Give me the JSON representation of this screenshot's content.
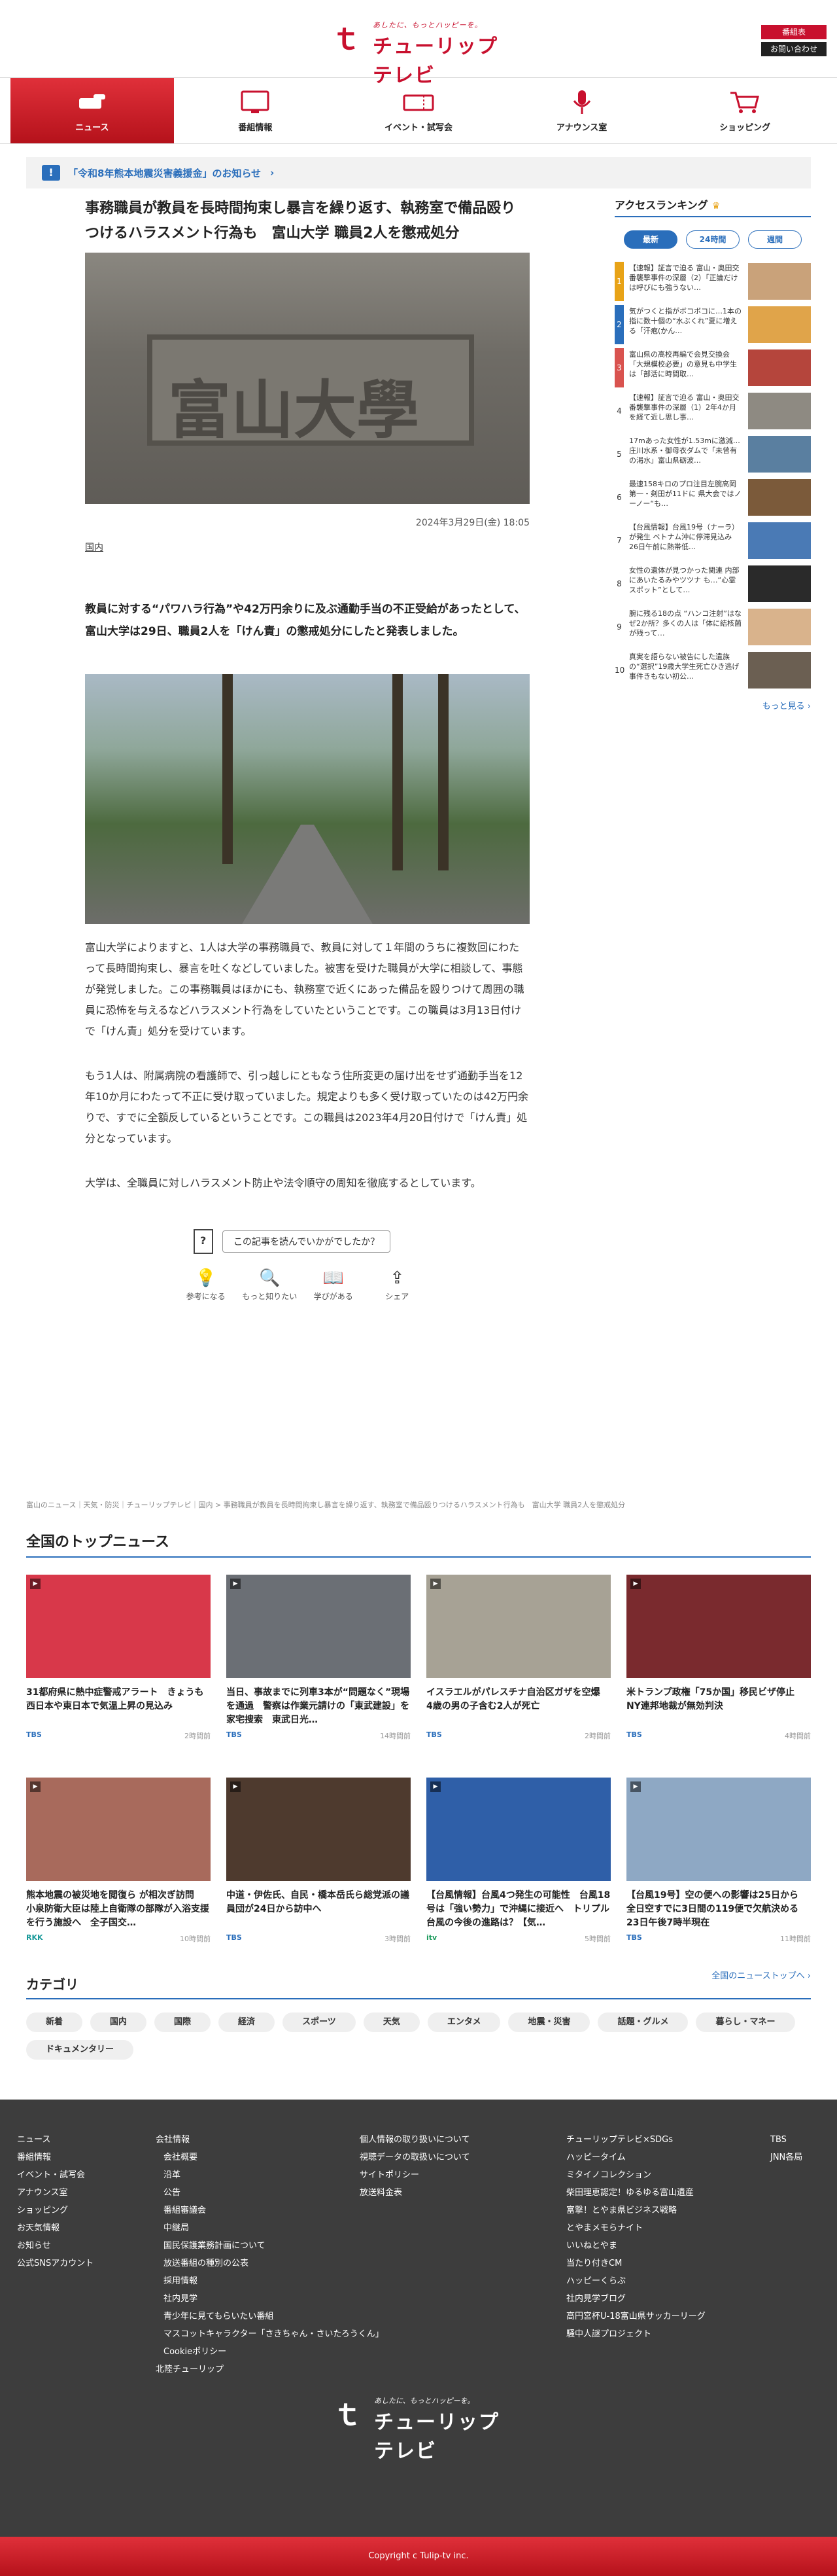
{
  "header": {
    "logo_tagline": "あしたに、もっとハッピーを。",
    "logo_name": "チューリップテレビ",
    "program_table": "番組表",
    "contact": "お問い合わせ"
  },
  "nav": [
    "ニュース",
    "番組情報",
    "イベント・試写会",
    "アナウンス室",
    "ショッピング"
  ],
  "notice": "「令和8年熊本地震災害義援金」のお知らせ",
  "article": {
    "title": "事務職員が教員を長時間拘束し暴言を繰り返す、執務室で備品殴りつけるハラスメント行為も　富山大学 職員2人を懲戒処分",
    "plate_text": "富山大學",
    "date": "2024年3月29日(金) 18:05",
    "category": "国内",
    "lead": "教員に対する“パワハラ行為”や42万円余りに及ぶ通勤手当の不正受給があったとして、富山大学は29日、職員2人を「けん責」の懲戒処分にしたと発表しました。",
    "paragraphs": [
      "富山大学によりますと、1人は大学の事務職員で、教員に対して１年間のうちに複数回にわたって長時間拘束し、暴言を吐くなどしていました。被害を受けた職員が大学に相談して、事態が発覚しました。この事務職員はほかにも、執務室で近くにあった備品を殴りつけて周囲の職員に恐怖を与えるなどハラスメント行為をしていたということです。この職員は3月13日付けで「けん責」処分を受けています。",
      "もう1人は、附属病院の看護師で、引っ越しにともなう住所変更の届け出をせず通勤手当を12年10か月にわたって不正に受け取っていました。規定よりも多く受け取っていたのは42万円余りで、すでに全額反しているということです。この職員は2023年4月20日付けで「けん責」処分となっています。",
      "大学は、全職員に対しハラスメント防止や法令順守の周知を徹底するとしています。"
    ],
    "feedback_q": "この記事を読んでいかがでしたか？",
    "feedback_actions": [
      "参考になる",
      "もっと知りたい",
      "学びがある",
      "シェア"
    ]
  },
  "ranking": {
    "title": "アクセスランキング",
    "tabs": [
      "最新",
      "24時間",
      "週間"
    ],
    "items": [
      {
        "rank": "1",
        "text": "【速報】証言で迫る 富山・奥田交番襲撃事件の深層（2）「正論だけは呼びにも強うない…"
      },
      {
        "rank": "2",
        "text": "気がつくと指がボコボコに…1本の指に数十個の“水ぶくれ”夏に増える「汗疱(かん…"
      },
      {
        "rank": "3",
        "text": "富山県の高校再編で会見交換会「大規模校必要」の意見も中学生は「部活に時間取…"
      },
      {
        "rank": "4",
        "text": "【速報】証言で迫る 富山・奥田交番襲撃事件の深層（1）2年4か月を経て近し思し事…"
      },
      {
        "rank": "5",
        "text": "17mあった女性が1.53mに激減…庄川水系・御母衣ダムで「未曾有の渇水」富山県砺波…"
      },
      {
        "rank": "6",
        "text": "最速158キロのプロ注目左腕高岡第一・剣田が11ドに 県大会ではノーノー“も…"
      },
      {
        "rank": "7",
        "text": "【台風情報】台風19号（ナーラ）が発生 ベトナム沖に停滞見込み 26日午前に熱帯低…"
      },
      {
        "rank": "8",
        "text": "女性の遺体が見つかった関連 内部にあいたるみやツツナ も…“心霊スポット”として…"
      },
      {
        "rank": "9",
        "text": "腕に残る18の点 “ハンコ注射”はなぜ2か所？多くの人は「体に結核菌が残って…"
      },
      {
        "rank": "10",
        "text": "真実を語らない被告にした遺族の“選択”19歳大学生死亡ひき逃げ事件きもない初公…"
      }
    ],
    "more": "もっと見る"
  },
  "breadcrumb": "富山のニュース｜天気・防災｜チューリップテレビ｜国内 > 事務職員が教員を長時間拘束し暴言を繰り返す、執務室で備品殴りつけるハラスメント行為も　富山大学 職員2人を懲戒処分",
  "topnews": {
    "title": "全国のトップニュース",
    "items": [
      {
        "title": "31都府県に熱中症警戒アラート　きょうも西日本や東日本で気温上昇の見込み",
        "src": "TBS",
        "time": "2時間前",
        "bg": "#d8384a"
      },
      {
        "title": "当日、事故までに列車3本が“問題なく”現場を通過　警察は作業元請けの「東武建設」を家宅捜索　東武日光…",
        "src": "TBS",
        "time": "14時間前",
        "bg": "#6b6f75"
      },
      {
        "title": "イスラエルがパレスチナ自治区ガザを空爆　4歳の男の子含む2人が死亡",
        "src": "TBS",
        "time": "2時間前",
        "bg": "#a7a295"
      },
      {
        "title": "米トランプ政権「75か国」移民ビザ停止　NY連邦地裁が無効判決",
        "src": "TBS",
        "time": "4時間前",
        "bg": "#7a2a2e"
      },
      {
        "title": "熊本地震の被災地を閲復ら が相次ぎ訪問　小泉防衛大臣は陸上自衛隊の部隊が入浴支援を行う施設へ　全子国交…",
        "src": "RKK",
        "time": "10時間前",
        "bg": "#a86a5c"
      },
      {
        "title": "中道・伊佐氏、自民・橋本岳氏ら総党派の議員団が24日から訪中へ",
        "src": "TBS",
        "time": "3時間前",
        "bg": "#4e3a2e"
      },
      {
        "title": "【台風情報】台風4つ発生の可能性　台風18号は「強い勢力」で沖縄に接近へ　トリプル台風の今後の進路は？【気…",
        "src": "itv",
        "time": "5時間前",
        "bg": "#2f5fa8"
      },
      {
        "title": "【台風19号】空の便への影響は25日から　全日空すでに3日間の119便で欠航決める　23日午後7時半現在",
        "src": "TBS",
        "time": "11時間前",
        "bg": "#8ea8c4"
      }
    ],
    "more": "全国のニューストップへ"
  },
  "categories": {
    "title": "カテゴリ",
    "items": [
      "新着",
      "国内",
      "国際",
      "経済",
      "スポーツ",
      "天気",
      "エンタメ",
      "地震・災害",
      "話題・グルメ",
      "暮らし・マネー",
      "ドキュメンタリー"
    ]
  },
  "footer": {
    "col1": [
      "ニュース",
      "番組情報",
      "イベント・試写会",
      "アナウンス室",
      "ショッピング",
      "お天気情報",
      "お知らせ",
      "公式SNSアカウント"
    ],
    "col2_head": "会社情報",
    "col2": [
      "会社概要",
      "沿革",
      "公告",
      "番組審議会",
      "中継局",
      "国民保護業務計画について",
      "放送番組の種別の公表",
      "採用情報",
      "社内見学",
      "青少年に見てもらいたい番組",
      "マスコットキャラクター「さきちゃん・さいたろうくん」",
      "Cookieポリシー"
    ],
    "col2_tail": "北陸チューリップ",
    "col3": [
      "個人情報の取り扱いについて",
      "視聴データの取扱いについて",
      "サイトポリシー",
      "放送料金表"
    ],
    "col4": [
      "チューリップテレビ×SDGs",
      "ハッピータイム",
      "ミタイノコレクション",
      "柴田理恵認定！ゆるゆる富山遺産",
      "富撃！とやま県ビジネス戦略",
      "とやまメモらナイト",
      "いいねとやま",
      "当たり付きCM",
      "ハッピーくらぶ",
      "社内見学ブログ",
      "高円宮杯U-18富山県サッカーリーグ",
      "騒中人謎プロジェクト"
    ],
    "col5": [
      "TBS",
      "JNN各局"
    ],
    "copyright": "Copyright c Tulip-tv inc."
  }
}
